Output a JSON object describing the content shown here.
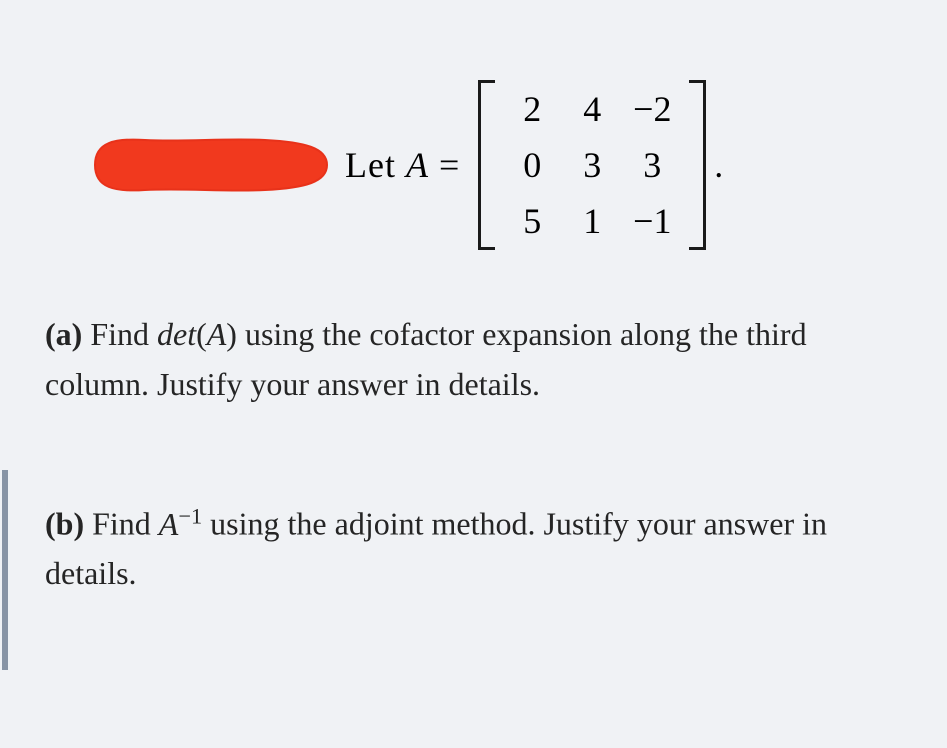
{
  "matrix_label_let": "Let ",
  "matrix_label_A": "A",
  "matrix_label_eq": " = ",
  "matrix": {
    "r1c1": "2",
    "r1c2": "4",
    "r1c3": "−2",
    "r2c1": "0",
    "r2c2": "3",
    "r2c3": "3",
    "r3c1": "5",
    "r3c2": "1",
    "r3c3": "−1"
  },
  "period": ".",
  "qa": {
    "label": "(a)",
    "t1": " Find ",
    "det": "det",
    "parenA": "(A)",
    "t2": " using the cofactor expansion along the third column.  Justify your answer in details."
  },
  "qb": {
    "label": "(b)",
    "t1": " Find ",
    "A": "A",
    "exp": "−1",
    "t2": " using the adjoint method. Justify your answer in details."
  }
}
